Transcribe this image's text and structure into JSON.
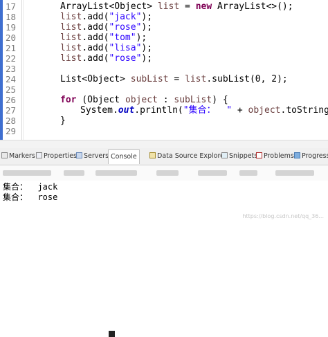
{
  "editor": {
    "lines": [
      {
        "num": "17",
        "indent": 1,
        "parts": [
          {
            "t": "ArrayList<Object> ",
            "c": ""
          },
          {
            "t": "list",
            "c": "var"
          },
          {
            "t": " = ",
            "c": ""
          },
          {
            "t": "new",
            "c": "kw"
          },
          {
            "t": " ArrayList<>();",
            "c": ""
          }
        ]
      },
      {
        "num": "18",
        "indent": 1,
        "parts": [
          {
            "t": "list",
            "c": "var"
          },
          {
            "t": ".add(",
            "c": ""
          },
          {
            "t": "\"jack\"",
            "c": "str"
          },
          {
            "t": ");",
            "c": ""
          }
        ]
      },
      {
        "num": "19",
        "indent": 1,
        "parts": [
          {
            "t": "list",
            "c": "var"
          },
          {
            "t": ".add(",
            "c": ""
          },
          {
            "t": "\"rose\"",
            "c": "str"
          },
          {
            "t": ");",
            "c": ""
          }
        ]
      },
      {
        "num": "20",
        "indent": 1,
        "parts": [
          {
            "t": "list",
            "c": "var"
          },
          {
            "t": ".add(",
            "c": ""
          },
          {
            "t": "\"tom\"",
            "c": "str"
          },
          {
            "t": ");",
            "c": ""
          }
        ]
      },
      {
        "num": "21",
        "indent": 1,
        "parts": [
          {
            "t": "list",
            "c": "var"
          },
          {
            "t": ".add(",
            "c": ""
          },
          {
            "t": "\"lisa\"",
            "c": "str"
          },
          {
            "t": ");",
            "c": ""
          }
        ]
      },
      {
        "num": "22",
        "indent": 1,
        "parts": [
          {
            "t": "list",
            "c": "var"
          },
          {
            "t": ".add(",
            "c": ""
          },
          {
            "t": "\"rose\"",
            "c": "str"
          },
          {
            "t": ");",
            "c": ""
          }
        ]
      },
      {
        "num": "23",
        "indent": 1,
        "parts": []
      },
      {
        "num": "24",
        "indent": 1,
        "parts": [
          {
            "t": "List<Object> ",
            "c": ""
          },
          {
            "t": "subList",
            "c": "var"
          },
          {
            "t": " = ",
            "c": ""
          },
          {
            "t": "list",
            "c": "var"
          },
          {
            "t": ".subList(0, 2);",
            "c": ""
          }
        ]
      },
      {
        "num": "25",
        "indent": 1,
        "parts": []
      },
      {
        "num": "26",
        "indent": 1,
        "parts": [
          {
            "t": "for",
            "c": "kw"
          },
          {
            "t": " (Object ",
            "c": ""
          },
          {
            "t": "object",
            "c": "var"
          },
          {
            "t": " : ",
            "c": ""
          },
          {
            "t": "subList",
            "c": "var"
          },
          {
            "t": ") {",
            "c": ""
          }
        ]
      },
      {
        "num": "27",
        "indent": 2,
        "parts": [
          {
            "t": "System.",
            "c": ""
          },
          {
            "t": "out",
            "c": "fld"
          },
          {
            "t": ".println(",
            "c": ""
          },
          {
            "t": "\"集合：  \"",
            "c": "str"
          },
          {
            "t": " + ",
            "c": ""
          },
          {
            "t": "object",
            "c": "var"
          },
          {
            "t": ".toString());",
            "c": ""
          }
        ]
      },
      {
        "num": "28",
        "indent": 1,
        "parts": [
          {
            "t": "}",
            "c": ""
          }
        ]
      },
      {
        "num": "29",
        "indent": 1,
        "parts": []
      }
    ]
  },
  "tabs": [
    {
      "label": "Markers",
      "icon": "markers-icon",
      "cls": "mark"
    },
    {
      "label": "Properties",
      "icon": "properties-icon",
      "cls": "props"
    },
    {
      "label": "Servers",
      "icon": "servers-icon",
      "cls": "server"
    },
    {
      "label": "Console",
      "icon": "console-icon",
      "cls": "console",
      "active": true
    },
    {
      "label": "Data Source Explorer",
      "icon": "data-source-icon",
      "cls": "ds"
    },
    {
      "label": "Snippets",
      "icon": "snippets-icon",
      "cls": "snip"
    },
    {
      "label": "Problems",
      "icon": "problems-icon",
      "cls": "prob"
    },
    {
      "label": "Progress",
      "icon": "progress-icon",
      "cls": "prog"
    }
  ],
  "console": {
    "lines": [
      "集合：  jack",
      "集合：  rose"
    ]
  },
  "watermark": "https://blog.csdn.net/qq_36...",
  "colors": {
    "keyword": "#7f0055",
    "string": "#2a00ff",
    "field": "#0000c0",
    "variable": "#6a3e3e",
    "line_number": "#7b7b7b"
  }
}
